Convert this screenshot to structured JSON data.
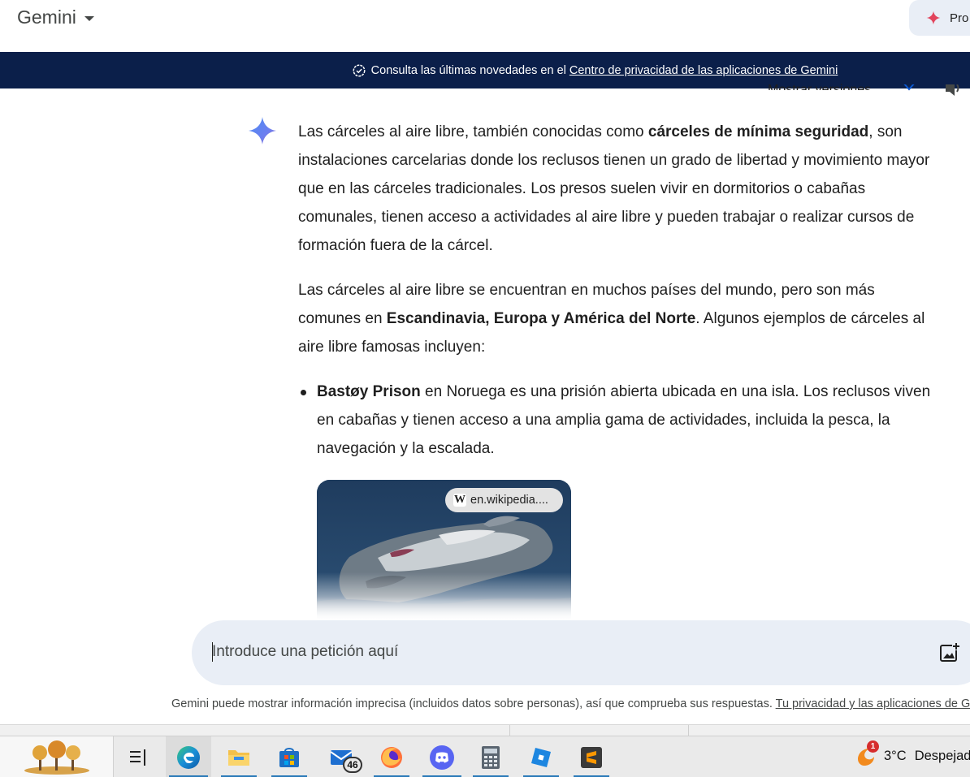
{
  "header": {
    "app_title": "Gemini",
    "pro_label": "Pro",
    "accent": "#e2445c"
  },
  "banner": {
    "text": "Consulta las últimas novedades en el",
    "link": "Centro de privacidad de las aplicaciones de Gemini",
    "bg": "#0b1f4a"
  },
  "response_header": {
    "versions_label": "Mostrar versiones"
  },
  "response": {
    "p1_a": "Las cárceles al aire libre, también conocidas como ",
    "p1_b": "cárceles de mínima seguridad",
    "p1_c": ", son instalaciones carcelarias donde los reclusos tienen un grado de libertad y movimiento mayor que en las cárceles tradicionales. Los presos suelen vivir en dormitorios o cabañas comunales, tienen acceso a actividades al aire libre y pueden trabajar o realizar cursos de formación fuera de la cárcel.",
    "p2_a": "Las cárceles al aire libre se encuentran en muchos países del mundo, pero son más comunes en ",
    "p2_b": "Escandinavia, Europa y América del Norte",
    "p2_c": ". Algunos ejemplos de cárceles al aire libre famosas incluyen:",
    "bullet1_a": "Bastøy Prison",
    "bullet1_b": " en Noruega es una prisión abierta ubicada en una isla. Los reclusos viven en cabañas y tienen acceso a una amplia gama de actividades, incluida la pesca, la navegación y la escalada."
  },
  "image_card": {
    "source_label": "en.wikipedia....",
    "source_icon": "W"
  },
  "input": {
    "placeholder": "Introduce una petición aquí"
  },
  "disclaimer": {
    "text": "Gemini puede mostrar información imprecisa (incluidos datos sobre personas), así que comprueba sus respuestas. ",
    "link": "Tu privacidad y las aplicaciones de Gemini"
  },
  "taskbar": {
    "mail_badge": "46",
    "weather_badge": "1",
    "weather_temp": "3°C",
    "weather_text": "Despejado"
  }
}
